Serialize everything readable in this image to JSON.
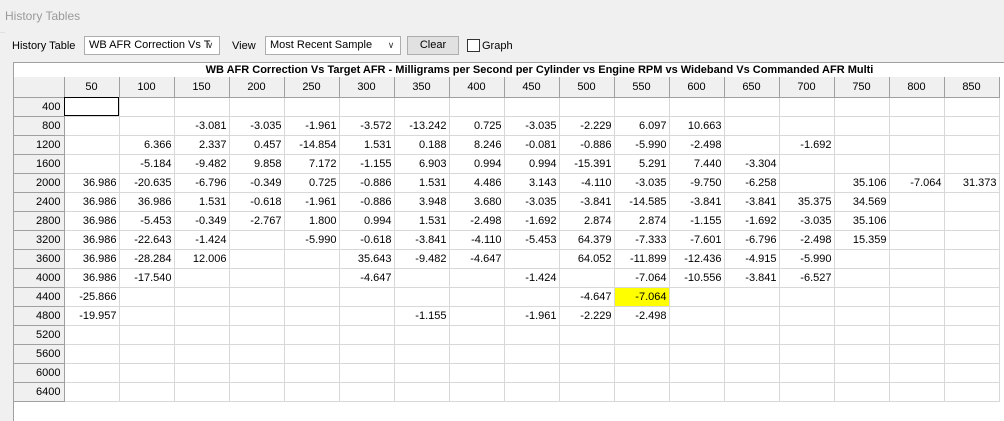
{
  "window_title": "History Tables",
  "toolbar": {
    "history_table_label": "History Table",
    "history_table_value": "WB AFR Correction Vs T",
    "view_label": "View",
    "view_value": "Most Recent Sample",
    "clear_label": "Clear",
    "graph_label": "Graph",
    "graph_checked": false
  },
  "table": {
    "title": "WB AFR Correction Vs Target AFR - Milligrams per Second per Cylinder vs Engine RPM vs Wideband Vs Commanded AFR Multi",
    "columns": [
      "50",
      "100",
      "150",
      "200",
      "250",
      "300",
      "350",
      "400",
      "450",
      "500",
      "550",
      "600",
      "650",
      "700",
      "750",
      "800",
      "850"
    ],
    "rows": [
      {
        "rpm": "400",
        "cells": [
          "",
          "",
          "",
          "",
          "",
          "",
          "",
          "",
          "",
          "",
          "",
          "",
          "",
          "",
          "",
          "",
          ""
        ]
      },
      {
        "rpm": "800",
        "cells": [
          "",
          "",
          "-3.081",
          "-3.035",
          "-1.961",
          "-3.572",
          "-13.242",
          "0.725",
          "-3.035",
          "-2.229",
          "6.097",
          "10.663",
          "",
          "",
          "",
          "",
          ""
        ]
      },
      {
        "rpm": "1200",
        "cells": [
          "",
          "6.366",
          "2.337",
          "0.457",
          "-14.854",
          "1.531",
          "0.188",
          "8.246",
          "-0.081",
          "-0.886",
          "-5.990",
          "-2.498",
          "",
          "-1.692",
          "",
          "",
          ""
        ]
      },
      {
        "rpm": "1600",
        "cells": [
          "",
          "-5.184",
          "-9.482",
          "9.858",
          "7.172",
          "-1.155",
          "6.903",
          "0.994",
          "0.994",
          "-15.391",
          "5.291",
          "7.440",
          "-3.304",
          "",
          "",
          "",
          ""
        ]
      },
      {
        "rpm": "2000",
        "cells": [
          "36.986",
          "-20.635",
          "-6.796",
          "-0.349",
          "0.725",
          "-0.886",
          "1.531",
          "4.486",
          "3.143",
          "-4.110",
          "-3.035",
          "-9.750",
          "-6.258",
          "",
          "35.106",
          "-7.064",
          "31.373"
        ]
      },
      {
        "rpm": "2400",
        "cells": [
          "36.986",
          "36.986",
          "1.531",
          "-0.618",
          "-1.961",
          "-0.886",
          "3.948",
          "3.680",
          "-3.035",
          "-3.841",
          "-14.585",
          "-3.841",
          "-3.841",
          "35.375",
          "34.569",
          "",
          ""
        ]
      },
      {
        "rpm": "2800",
        "cells": [
          "36.986",
          "-5.453",
          "-0.349",
          "-2.767",
          "1.800",
          "0.994",
          "1.531",
          "-2.498",
          "-1.692",
          "2.874",
          "2.874",
          "-1.155",
          "-1.692",
          "-3.035",
          "35.106",
          "",
          ""
        ]
      },
      {
        "rpm": "3200",
        "cells": [
          "36.986",
          "-22.643",
          "-1.424",
          "",
          "-5.990",
          "-0.618",
          "-3.841",
          "-4.110",
          "-5.453",
          "64.379",
          "-7.333",
          "-7.601",
          "-6.796",
          "-2.498",
          "15.359",
          "",
          ""
        ]
      },
      {
        "rpm": "3600",
        "cells": [
          "36.986",
          "-28.284",
          "12.006",
          "",
          "",
          "35.643",
          "-9.482",
          "-4.647",
          "",
          "64.052",
          "-11.899",
          "-12.436",
          "-4.915",
          "-5.990",
          "",
          "",
          ""
        ]
      },
      {
        "rpm": "4000",
        "cells": [
          "36.986",
          "-17.540",
          "",
          "",
          "",
          "-4.647",
          "",
          "",
          "-1.424",
          "",
          "-7.064",
          "-10.556",
          "-3.841",
          "-6.527",
          "",
          "",
          ""
        ]
      },
      {
        "rpm": "4400",
        "cells": [
          "-25.866",
          "",
          "",
          "",
          "",
          "",
          "",
          "",
          "",
          "-4.647",
          "-7.064",
          "",
          "",
          "",
          "",
          "",
          ""
        ]
      },
      {
        "rpm": "4800",
        "cells": [
          "-19.957",
          "",
          "",
          "",
          "",
          "",
          "-1.155",
          "",
          "-1.961",
          "-2.229",
          "-2.498",
          "",
          "",
          "",
          "",
          "",
          ""
        ]
      },
      {
        "rpm": "5200",
        "cells": [
          "",
          "",
          "",
          "",
          "",
          "",
          "",
          "",
          "",
          "",
          "",
          "",
          "",
          "",
          "",
          "",
          ""
        ]
      },
      {
        "rpm": "5600",
        "cells": [
          "",
          "",
          "",
          "",
          "",
          "",
          "",
          "",
          "",
          "",
          "",
          "",
          "",
          "",
          "",
          "",
          ""
        ]
      },
      {
        "rpm": "6000",
        "cells": [
          "",
          "",
          "",
          "",
          "",
          "",
          "",
          "",
          "",
          "",
          "",
          "",
          "",
          "",
          "",
          "",
          ""
        ]
      },
      {
        "rpm": "6400",
        "cells": [
          "",
          "",
          "",
          "",
          "",
          "",
          "",
          "",
          "",
          "",
          "",
          "",
          "",
          "",
          "",
          "",
          ""
        ]
      }
    ],
    "highlight_color": "#ffff00"
  }
}
